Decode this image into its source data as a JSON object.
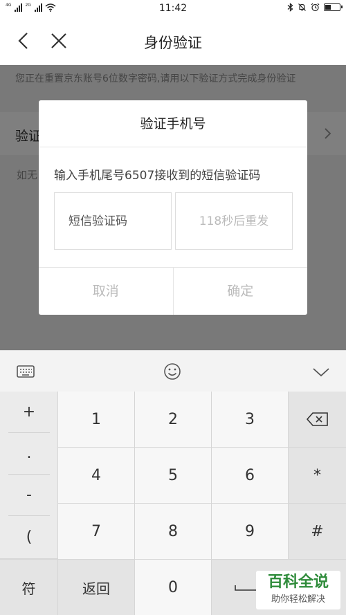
{
  "status_bar": {
    "signal1_label": "4G",
    "signal2_label": "2G",
    "time": "11:42",
    "battery_level": 0.4
  },
  "header": {
    "title": "身份验证"
  },
  "page": {
    "notice": "您正在重置京东账号6位数字密码,请用以下验证方式完成身份验证",
    "row_label": "验证",
    "hint": "如无"
  },
  "dialog": {
    "title": "验证手机号",
    "message": "输入手机尾号6507接收到的短信验证码",
    "code_placeholder": "短信验证码",
    "resend_label": "118秒后重发",
    "cancel_label": "取消",
    "confirm_label": "确定"
  },
  "keyboard": {
    "symbols": [
      "+",
      ".",
      "-",
      "("
    ],
    "digits": [
      "1",
      "2",
      "3",
      "4",
      "5",
      "6",
      "7",
      "8",
      "9",
      "0"
    ],
    "star": "*",
    "hash": "#",
    "sym_label": "符",
    "back_label": "返回"
  },
  "watermark": {
    "main": "百科全说",
    "sub": "助你轻松解决"
  }
}
